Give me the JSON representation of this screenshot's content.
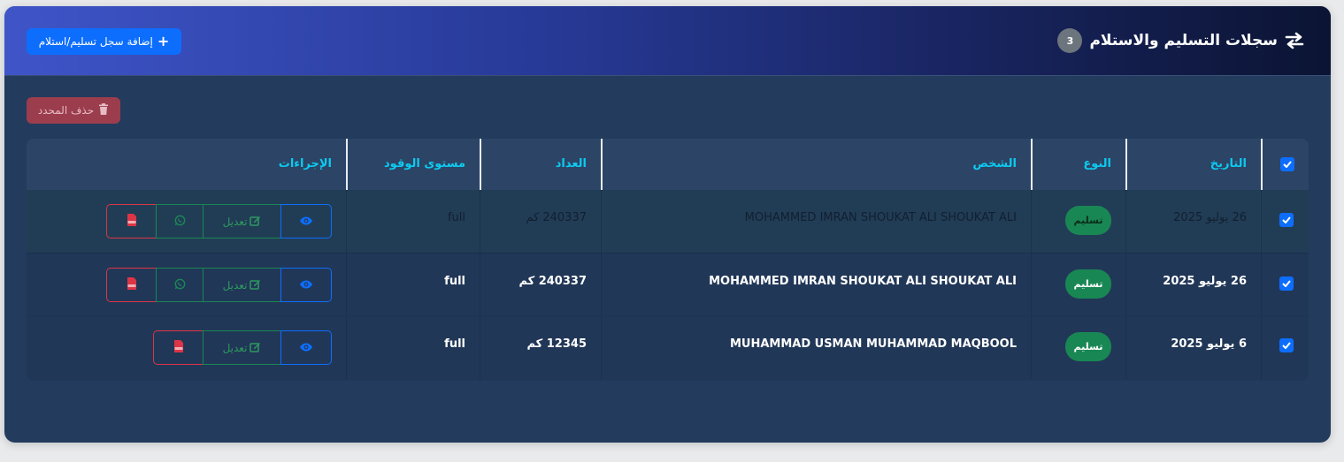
{
  "header": {
    "title": "سجلات التسليم والاستلام",
    "count": "3",
    "add_button_label": "إضافة سجل تسليم/استلام"
  },
  "toolbar": {
    "delete_selected_label": "حذف المحدد"
  },
  "table": {
    "columns": {
      "date": "التاريخ",
      "type": "النوع",
      "person": "الشخص",
      "meter": "العداد",
      "fuel": "مستوى الوقود",
      "actions": "الإجراءات"
    },
    "rows": [
      {
        "date": "26 يوليو 2025",
        "type": "تسليم",
        "person": "MOHAMMED IMRAN SHOUKAT ALI SHOUKAT ALI",
        "meter": "240337 كم",
        "fuel": "full",
        "edit_label": "تعديل",
        "has_whatsapp": true,
        "checked": true
      },
      {
        "date": "26 يوليو 2025",
        "type": "تسليم",
        "person": "MOHAMMED IMRAN SHOUKAT ALI SHOUKAT ALI",
        "meter": "240337 كم",
        "fuel": "full",
        "edit_label": "تعديل",
        "has_whatsapp": true,
        "checked": true
      },
      {
        "date": "6 يوليو 2025",
        "type": "تسليم",
        "person": "MUHAMMAD USMAN MUHAMMAD MAQBOOL",
        "meter": "12345 كم",
        "fuel": "full",
        "edit_label": "تعديل",
        "has_whatsapp": false,
        "checked": true
      }
    ]
  },
  "colors": {
    "primary": "#0d6efd",
    "success": "#198754",
    "danger": "#dc3545",
    "info": "#0dcaf0",
    "card_bg": "#233b5d"
  },
  "icons": {
    "title": "exchange-arrows-icon",
    "add": "plus-icon",
    "delete": "trash-icon",
    "view": "eye-icon",
    "edit": "edit-icon",
    "whatsapp": "whatsapp-icon",
    "pdf": "pdf-icon"
  }
}
